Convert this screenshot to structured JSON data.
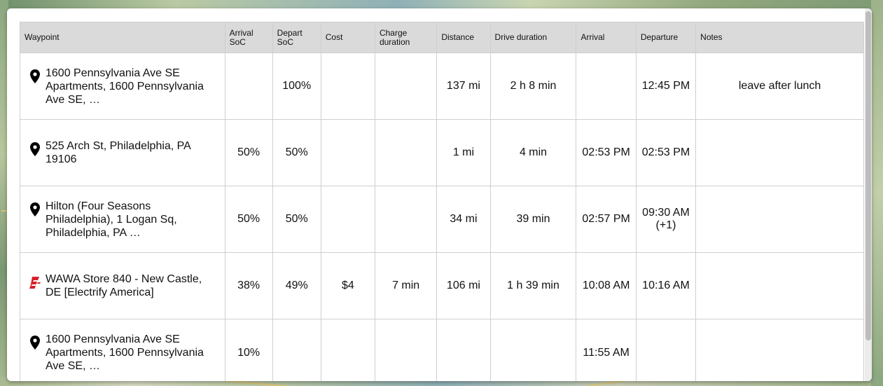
{
  "columns": {
    "waypoint": "Waypoint",
    "arrival_soc": "Arrival SoC",
    "depart_soc": "Depart SoC",
    "cost": "Cost",
    "charge_duration": "Charge duration",
    "distance": "Distance",
    "drive_duration": "Drive duration",
    "arrival": "Arrival",
    "departure": "Departure",
    "notes": "Notes"
  },
  "rows": [
    {
      "icon": "map-pin-icon",
      "waypoint": "1600 Pennsylvania Ave SE Apartments, 1600 Pennsylvania Ave SE, …",
      "arrival_soc": "",
      "depart_soc": "100%",
      "cost": "",
      "charge_duration": "",
      "distance": "137 mi",
      "drive_duration": "2 h 8 min",
      "arrival": "",
      "departure": "12:45 PM",
      "notes": "leave after lunch"
    },
    {
      "icon": "map-pin-icon",
      "waypoint": "525 Arch St, Philadelphia, PA 19106",
      "arrival_soc": "50%",
      "depart_soc": "50%",
      "cost": "",
      "charge_duration": "",
      "distance": "1 mi",
      "drive_duration": "4 min",
      "arrival": "02:53 PM",
      "departure": "02:53 PM",
      "notes": ""
    },
    {
      "icon": "map-pin-icon",
      "waypoint": "Hilton (Four Seasons Philadelphia), 1 Logan Sq, Philadelphia, PA …",
      "arrival_soc": "50%",
      "depart_soc": "50%",
      "cost": "",
      "charge_duration": "",
      "distance": "34 mi",
      "drive_duration": "39 min",
      "arrival": "02:57 PM",
      "departure": "09:30 AM (+1)",
      "notes": ""
    },
    {
      "icon": "electrify-america-icon",
      "waypoint": "WAWA Store 840 - New Castle, DE [Electrify America]",
      "arrival_soc": "38%",
      "depart_soc": "49%",
      "cost": "$4",
      "charge_duration": "7 min",
      "distance": "106 mi",
      "drive_duration": "1 h 39 min",
      "arrival": "10:08 AM",
      "departure": "10:16 AM",
      "notes": ""
    },
    {
      "icon": "map-pin-icon",
      "waypoint": "1600 Pennsylvania Ave SE Apartments, 1600 Pennsylvania Ave SE, …",
      "arrival_soc": "10%",
      "depart_soc": "",
      "cost": "",
      "charge_duration": "",
      "distance": "",
      "drive_duration": "",
      "arrival": "11:55 AM",
      "departure": "",
      "notes": ""
    }
  ],
  "colors": {
    "header_bg": "#dadada",
    "pin": "#000000",
    "electrify_brand": "#d6212b"
  }
}
